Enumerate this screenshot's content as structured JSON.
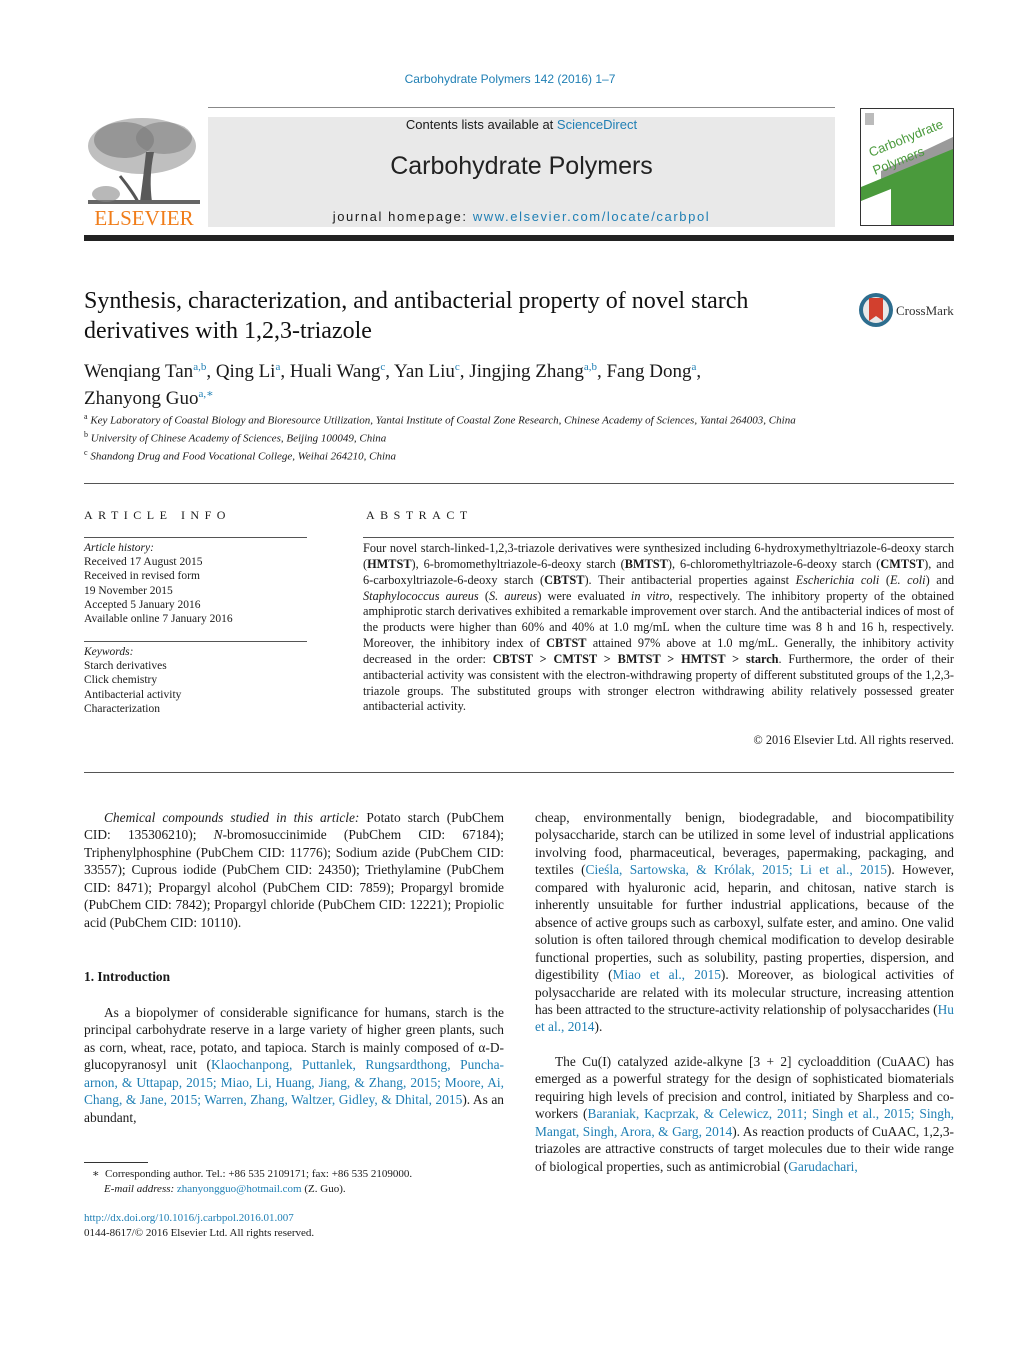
{
  "journal_ref": "Carbohydrate Polymers 142 (2016) 1–7",
  "header": {
    "contents_prefix": "Contents lists available at ",
    "contents_link": "ScienceDirect",
    "journal_title": "Carbohydrate Polymers",
    "homepage_prefix": "journal homepage: ",
    "homepage_link": "www.elsevier.com/locate/carbpol",
    "publisher_logo_text": "ELSEVIER",
    "cover_title_line1": "Carbohydrate",
    "cover_title_line2": "Polymers",
    "colors": {
      "link": "#1f7fb4",
      "elsevier_orange": "#f07d1a",
      "cover_green": "#4a9a3c",
      "masthead_bg": "#e9e9e9"
    }
  },
  "article": {
    "title": "Synthesis, characterization, and antibacterial property of novel starch derivatives with 1,2,3-triazole",
    "crossmark_label": "CrossMark",
    "authors": [
      {
        "name": "Wenqiang Tan",
        "sup": "a,b"
      },
      {
        "name": "Qing Li",
        "sup": "a"
      },
      {
        "name": "Huali Wang",
        "sup": "c"
      },
      {
        "name": "Yan Liu",
        "sup": "c"
      },
      {
        "name": "Jingjing Zhang",
        "sup": "a,b"
      },
      {
        "name": "Fang Dong",
        "sup": "a"
      },
      {
        "name": "Zhanyong Guo",
        "sup": "a,∗"
      }
    ],
    "affiliations": [
      {
        "mark": "a",
        "text": "Key Laboratory of Coastal Biology and Bioresource Utilization, Yantai Institute of Coastal Zone Research, Chinese Academy of Sciences, Yantai 264003, China"
      },
      {
        "mark": "b",
        "text": "University of Chinese Academy of Sciences, Beijing 100049, China"
      },
      {
        "mark": "c",
        "text": "Shandong Drug and Food Vocational College, Weihai 264210, China"
      }
    ]
  },
  "article_info": {
    "heading": "ARTICLE INFO",
    "history_label": "Article history:",
    "history": [
      "Received 17 August 2015",
      "Received in revised form",
      "19 November 2015",
      "Accepted 5 January 2016",
      "Available online 7 January 2016"
    ],
    "keywords_label": "Keywords:",
    "keywords": [
      "Starch derivatives",
      "Click chemistry",
      "Antibacterial activity",
      "Characterization"
    ]
  },
  "abstract": {
    "heading": "ABSTRACT",
    "segments": [
      {
        "t": "Four novel starch-linked-1,2,3-triazole derivatives were synthesized including 6-hydroxymethyltriazole-6-deoxy starch ("
      },
      {
        "t": "HMTST",
        "b": true
      },
      {
        "t": "), 6-bromomethyltriazole-6-deoxy starch ("
      },
      {
        "t": "BMTST",
        "b": true
      },
      {
        "t": "), 6-chloromethyltriazole-6-deoxy starch ("
      },
      {
        "t": "CMTST",
        "b": true
      },
      {
        "t": "), and 6-carboxyltriazole-6-deoxy starch ("
      },
      {
        "t": "CBTST",
        "b": true
      },
      {
        "t": "). Their antibacterial properties against "
      },
      {
        "t": "Escherichia coli",
        "i": true
      },
      {
        "t": " ("
      },
      {
        "t": "E. coli",
        "i": true
      },
      {
        "t": ") and "
      },
      {
        "t": "Staphylococcus aureus",
        "i": true
      },
      {
        "t": " ("
      },
      {
        "t": "S. aureus",
        "i": true
      },
      {
        "t": ") were evaluated "
      },
      {
        "t": "in vitro",
        "i": true
      },
      {
        "t": ", respectively. The inhibitory property of the obtained amphiprotic starch derivatives exhibited a remarkable improvement over starch. And the antibacterial indices of most of the products were higher than 60% and 40% at 1.0 mg/mL when the culture time was 8 h and 16 h, respectively. Moreover, the inhibitory index of "
      },
      {
        "t": "CBTST",
        "b": true
      },
      {
        "t": " attained 97% above at 1.0 mg/mL. Generally, the inhibitory activity decreased in the order: "
      },
      {
        "t": "CBTST > CMTST > BMTST > HMTST > starch",
        "b": true
      },
      {
        "t": ". Furthermore, the order of their antibacterial activity was consistent with the electron-withdrawing property of different substituted groups of the 1,2,3-triazole groups. The substituted groups with stronger electron withdrawing ability relatively possessed greater antibacterial activity."
      }
    ],
    "copyright": "© 2016 Elsevier Ltd. All rights reserved."
  },
  "body": {
    "compounds": [
      {
        "t": "Chemical compounds studied in this article:",
        "i": true
      },
      {
        "t": " Potato starch (PubChem CID: 135306210); "
      },
      {
        "t": "N",
        "i": true
      },
      {
        "t": "-bromosuccinimide (PubChem CID: 67184); Triphenylphosphine (PubChem CID: 11776); Sodium azide (PubChem CID: 33557); Cuprous iodide (PubChem CID: 24350); Triethylamine (PubChem CID: 8471); Propargyl alcohol (PubChem CID: 7859); Propargyl bromide (PubChem CID: 7842); Propargyl chloride (PubChem CID: 12221); Propiolic acid (PubChem CID: 10110)."
      }
    ],
    "intro_heading": "1.  Introduction",
    "intro_left": [
      {
        "t": "As a biopolymer of considerable significance for humans, starch is the principal carbohydrate reserve in a large variety of higher green plants, such as corn, wheat, race, potato, and tapioca. Starch is mainly composed of α-D-glucopyranosyl unit ("
      },
      {
        "t": "Klaochanpong, Puttanlek, Rungsardthong, Puncha-arnon, & Uttapap, 2015; Miao, Li, Huang, Jiang, & Zhang, 2015; Moore, Ai, Chang, & Jane, 2015; Warren, Zhang, Waltzer, Gidley, & Dhital, 2015",
        "link": true
      },
      {
        "t": "). As an abundant,"
      }
    ],
    "right_p1": [
      {
        "t": "cheap, environmentally benign, biodegradable, and biocompatibility polysaccharide, starch can be utilized in some level of industrial applications involving food, pharmaceutical, beverages, papermaking, packaging, and textiles ("
      },
      {
        "t": "Cieśla, Sartowska, & Królak, 2015; Li et al., 2015",
        "link": true
      },
      {
        "t": "). However, compared with hyaluronic acid, heparin, and chitosan, native starch is inherently unsuitable for further industrial applications, because of the absence of active groups such as carboxyl, sulfate ester, and amino. One valid solution is often tailored through chemical modification to develop desirable functional properties, such as solubility, pasting properties, dispersion, and digestibility ("
      },
      {
        "t": "Miao et al., 2015",
        "link": true
      },
      {
        "t": "). Moreover, as biological activities of polysaccharide are related with its molecular structure, increasing attention has been attracted to the structure-activity relationship of polysaccharides ("
      },
      {
        "t": "Hu et al., 2014",
        "link": true
      },
      {
        "t": ")."
      }
    ],
    "right_p2": [
      {
        "t": "The Cu(I) catalyzed azide-alkyne [3 + 2] cycloaddition (CuAAC) has emerged as a powerful strategy for the design of sophisticated biomaterials requiring high levels of precision and control, initiated by Sharpless and co-workers ("
      },
      {
        "t": "Baraniak, Kacprzak, & Celewicz, 2011; Singh et al., 2015; Singh, Mangat, Singh, Arora, & Garg, 2014",
        "link": true
      },
      {
        "t": "). As reaction products of CuAAC, 1,2,3-triazoles are attractive constructs of target molecules due to their wide range of biological properties, such as antimicrobial ("
      },
      {
        "t": "Garudachari,",
        "link": true
      }
    ]
  },
  "footnote": {
    "star": "∗",
    "corresponding": "Corresponding author. Tel.: +86 535 2109171; fax: +86 535 2109000.",
    "email_label": "E-mail address:",
    "email": "zhanyongguo@hotmail.com",
    "email_suffix": " (Z. Guo)."
  },
  "doi": {
    "url": "http://dx.doi.org/10.1016/j.carbpol.2016.01.007",
    "issn_line": "0144-8617/© 2016 Elsevier Ltd. All rights reserved."
  }
}
